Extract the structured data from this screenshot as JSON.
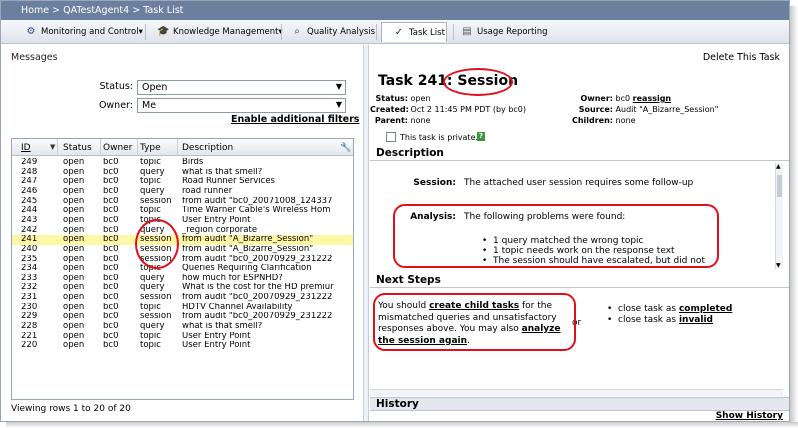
{
  "breadcrumb": {
    "home": "Home",
    "sep1": ">",
    "agent": "QATestAgent4",
    "sep2": ">",
    "current": "Task List"
  },
  "nav": {
    "items": [
      {
        "label": "Monitoring and Control▾",
        "icon": "gear-icon"
      },
      {
        "label": "Knowledge Management▾",
        "icon": "mortarboard-icon"
      },
      {
        "label": "Quality Analysis",
        "icon": "magnifier-icon"
      },
      {
        "label": "Task List",
        "icon": "checkmark-icon",
        "active": true
      },
      {
        "label": "Usage Reporting",
        "icon": "report-icon"
      }
    ]
  },
  "left": {
    "messages": "Messages",
    "status_label": "Status:",
    "status_value": "Open",
    "owner_label": "Owner:",
    "owner_value": "Me",
    "enable_filters": "Enable additional filters",
    "columns": [
      "ID",
      "Status",
      "Owner",
      "Type",
      "Description"
    ],
    "rows": [
      [
        "249",
        "open",
        "bc0",
        "topic",
        "Birds"
      ],
      [
        "248",
        "open",
        "bc0",
        "query",
        "what is that smell?"
      ],
      [
        "247",
        "open",
        "bc0",
        "topic",
        "Road Runner Services"
      ],
      [
        "246",
        "open",
        "bc0",
        "query",
        "road runner"
      ],
      [
        "245",
        "open",
        "bc0",
        "session",
        "from audit \"bc0_20071008_124337"
      ],
      [
        "244",
        "open",
        "bc0",
        "topic",
        "Time Warner Cable's Wireless Hom"
      ],
      [
        "243",
        "open",
        "bc0",
        "topic",
        "User Entry Point"
      ],
      [
        "242",
        "open",
        "bc0",
        "query",
        "_region corporate"
      ],
      [
        "241",
        "open",
        "bc0",
        "session",
        "from audit \"A_Bizarre_Session\""
      ],
      [
        "240",
        "open",
        "bc0",
        "session",
        "from audit \"A_Bizarre_Session\""
      ],
      [
        "235",
        "open",
        "bc0",
        "session",
        "from audit \"bc0_20070929_231222"
      ],
      [
        "234",
        "open",
        "bc0",
        "topic",
        "Queries Requiring Clarification"
      ],
      [
        "233",
        "open",
        "bc0",
        "query",
        "how much for ESPNHD?"
      ],
      [
        "232",
        "open",
        "bc0",
        "query",
        "What is the cost for the HD premiur"
      ],
      [
        "231",
        "open",
        "bc0",
        "session",
        "from audit \"bc0_20070929_231222"
      ],
      [
        "230",
        "open",
        "bc0",
        "topic",
        "HDTV Channel Availability"
      ],
      [
        "229",
        "open",
        "bc0",
        "session",
        "from audit \"bc0_20070929_231222"
      ],
      [
        "228",
        "open",
        "bc0",
        "query",
        "what is that smell?"
      ],
      [
        "221",
        "open",
        "bc0",
        "topic",
        "User Entry Point"
      ],
      [
        "220",
        "open",
        "bc0",
        "topic",
        "User Entry Point"
      ]
    ],
    "selected_row_id": "241",
    "viewing": "Viewing rows 1 to 20 of 20"
  },
  "right": {
    "delete_task": "Delete This Task",
    "task_prefix": "Task 241:",
    "task_name": "Session",
    "status_label": "Status:",
    "status_value": "open",
    "created_label": "Created:",
    "created_value": "Oct 2 11:45 PM PDT (by bc0)",
    "parent_label": "Parent:",
    "parent_value": "none",
    "owner_label": "Owner:",
    "owner_value": "bc0",
    "reassign": "reassign",
    "source_label": "Source:",
    "source_value": "Audit \"A_Bizarre_Session\"",
    "children_label": "Children:",
    "children_value": "none",
    "private_text": "This task is private.",
    "help": "?",
    "description_head": "Description",
    "session_label": "Session:",
    "session_text": "The attached user session requires some follow-up",
    "analysis_label": "Analysis:",
    "analysis_text": "The following problems were found:",
    "bullets": [
      "1 query matched the wrong topic",
      "1 topic needs work on the response text",
      "The session should have escalated, but did not"
    ],
    "next_steps_head": "Next Steps",
    "ns_pre": "You should ",
    "ns_link1": "create child tasks",
    "ns_mid": " for the mismatched queries and unsatisfactory responses above. You may also ",
    "ns_link2": "analyze the session again",
    "ns_end": ".",
    "or": "or",
    "close1_pre": "close task as ",
    "close1_link": "completed",
    "close2_pre": "close task as ",
    "close2_link": "invalid",
    "history_head": "History",
    "show_history": "Show History"
  }
}
